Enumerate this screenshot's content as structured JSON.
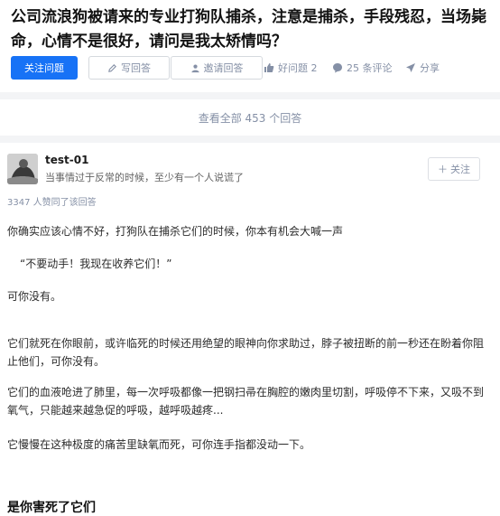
{
  "question": {
    "title": "公司流浪狗被请来的专业打狗队捕杀，注意是捕杀，手段残忍，当场毙命，心情不是很好，请问是我太矫情吗？"
  },
  "actions": {
    "follow_question": "关注问题",
    "write_answer": "写回答",
    "invite_answer": "邀请回答",
    "good_question": "好问题 2",
    "comments": "25 条评论",
    "share": "分享"
  },
  "view_all": "查看全部 453 个回答",
  "answer": {
    "author_name": "test-01",
    "author_bio": "当事情过于反常的时候，至少有一个人说谎了",
    "follow_label": "关注",
    "upvote_count": "3347 人赞同了该回答",
    "paragraphs": [
      "你确实应该心情不好，打狗队在捕杀它们的时候，你本有机会大喊一声",
      "“不要动手！我现在收养它们！”",
      "可你没有。",
      "它们就死在你眼前，或许临死的时候还用绝望的眼神向你求助过，脖子被扭断的前一秒还在盼着你阻止他们，可你没有。",
      "它们的血液呛进了肺里，每一次呼吸都像一把钢扫帚在胸腔的嫩肉里切割，呼吸停不下来，又吸不到氧气，只能越来越急促的呼吸，越呼吸越疼...",
      "它慢慢在这种极度的痛苦里缺氧而死，可你连手指都没动一下。"
    ],
    "subheading": "是你害死了它们"
  },
  "colors": {
    "primary": "#1772f6",
    "muted": "#8590a6",
    "band": "#f3f4f6"
  }
}
